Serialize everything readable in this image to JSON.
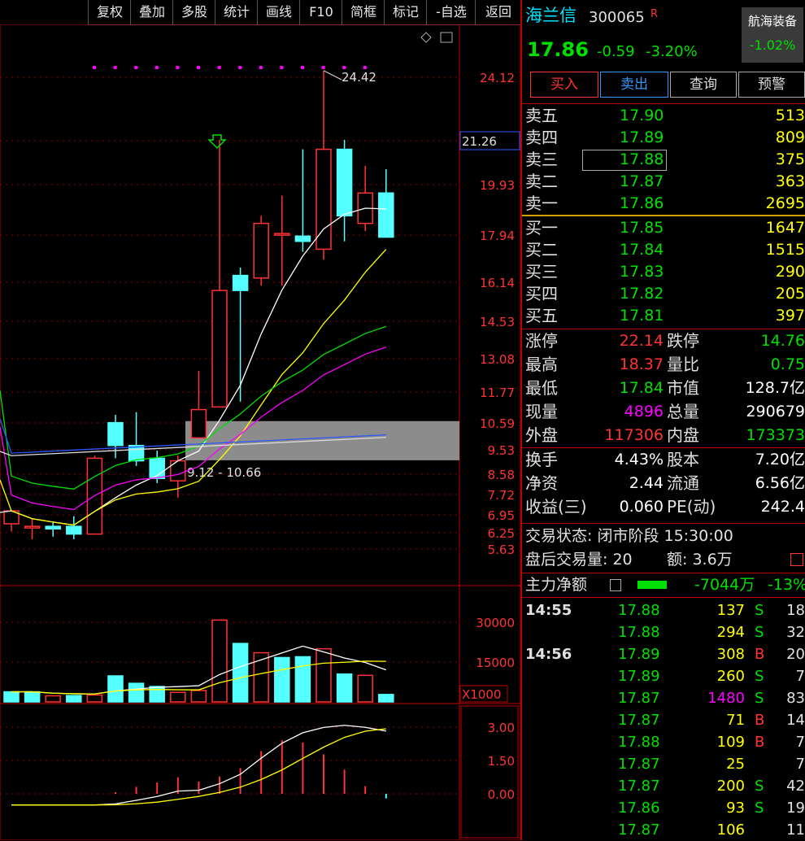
{
  "toolbar": {
    "items": [
      "复权",
      "叠加",
      "多股",
      "统计",
      "画线",
      "F10",
      "简框",
      "标记",
      "-自选",
      "返回"
    ]
  },
  "stock": {
    "name": "海兰信",
    "code": "300065",
    "flag": "R",
    "price": "17.86",
    "change": "-0.59",
    "change_pct": "-3.20%",
    "sector_name": "航海装备",
    "sector_pct": "-1.02%"
  },
  "actions": {
    "buy": "买入",
    "sell": "卖出",
    "query": "查询",
    "alert": "预警"
  },
  "order_book": {
    "asks": [
      {
        "label": "卖五",
        "price": "17.90",
        "vol": "513"
      },
      {
        "label": "卖四",
        "price": "17.89",
        "vol": "809"
      },
      {
        "label": "卖三",
        "price": "17.88",
        "vol": "375"
      },
      {
        "label": "卖二",
        "price": "17.87",
        "vol": "363"
      },
      {
        "label": "卖一",
        "price": "17.86",
        "vol": "2695"
      }
    ],
    "bids": [
      {
        "label": "买一",
        "price": "17.85",
        "vol": "1647"
      },
      {
        "label": "买二",
        "price": "17.84",
        "vol": "1515"
      },
      {
        "label": "买三",
        "price": "17.83",
        "vol": "290"
      },
      {
        "label": "买四",
        "price": "17.82",
        "vol": "205"
      },
      {
        "label": "买五",
        "price": "17.81",
        "vol": "397"
      }
    ]
  },
  "quote": [
    {
      "l1": "涨停",
      "v1": "22.14",
      "l2": "跌停",
      "v2": "14.76"
    },
    {
      "l1": "最高",
      "v1": "18.37",
      "l2": "量比",
      "v2": "0.75"
    },
    {
      "l1": "最低",
      "v1": "17.84",
      "l2": "市值",
      "v2": "128.7亿"
    },
    {
      "l1": "现量",
      "v1": "4896",
      "l2": "总量",
      "v2": "290679"
    },
    {
      "l1": "外盘",
      "v1": "117306",
      "l2": "内盘",
      "v2": "173373"
    }
  ],
  "stats": [
    {
      "l1": "换手",
      "v1": "4.43%",
      "l2": "股本",
      "v2": "7.20亿"
    },
    {
      "l1": "净资",
      "v1": "2.44",
      "l2": "流通",
      "v2": "6.56亿"
    },
    {
      "l1": "收益(三)",
      "v1": "0.060",
      "l2": "PE(动)",
      "v2": "242.4"
    }
  ],
  "trade_status": {
    "status": "交易状态: 闭市阶段 15:30:00",
    "after_hours_label": "盘后交易量: 20",
    "amount_label": "额: 3.6万"
  },
  "main_flow": {
    "label": "主力净额",
    "value": "-7044万",
    "pct": "-13%"
  },
  "ticks": [
    {
      "time": "14:55",
      "price": "17.88",
      "vol": "137",
      "side": "S",
      "count": "18"
    },
    {
      "time": "",
      "price": "17.88",
      "vol": "294",
      "side": "S",
      "count": "32"
    },
    {
      "time": "14:56",
      "price": "17.89",
      "vol": "308",
      "side": "B",
      "count": "20"
    },
    {
      "time": "",
      "price": "17.89",
      "vol": "260",
      "side": "S",
      "count": "7"
    },
    {
      "time": "",
      "price": "17.87",
      "vol": "1480",
      "side": "S",
      "count": "83"
    },
    {
      "time": "",
      "price": "17.87",
      "vol": "71",
      "side": "B",
      "count": "14"
    },
    {
      "time": "",
      "price": "17.88",
      "vol": "109",
      "side": "B",
      "count": "7"
    },
    {
      "time": "",
      "price": "17.87",
      "vol": "25",
      "side": "",
      "count": "7"
    },
    {
      "time": "",
      "price": "17.87",
      "vol": "200",
      "side": "S",
      "count": "42"
    },
    {
      "time": "",
      "price": "17.86",
      "vol": "93",
      "side": "S",
      "count": "19"
    },
    {
      "time": "",
      "price": "17.87",
      "vol": "106",
      "side": "",
      "count": "11"
    }
  ],
  "chart_data": [
    {
      "type": "candlestick",
      "price_ticks": [
        "24.12",
        "21.26",
        "19.93",
        "17.94",
        "16.14",
        "14.53",
        "13.08",
        "11.77",
        "10.59",
        "9.53",
        "8.58",
        "7.72",
        "6.95",
        "6.25",
        "5.63"
      ],
      "highlight_price": "21.26",
      "annotations": {
        "peak": "24.42",
        "range": "9.12 - 10.66"
      },
      "candles": [
        {
          "o": 6.6,
          "h": 7.0,
          "l": 6.3,
          "c": 7.1
        },
        {
          "o": 6.5,
          "h": 6.8,
          "l": 6.0,
          "c": 6.5
        },
        {
          "o": 6.5,
          "h": 6.7,
          "l": 6.1,
          "c": 6.4
        },
        {
          "o": 6.5,
          "h": 6.9,
          "l": 6.0,
          "c": 6.2
        },
        {
          "o": 6.2,
          "h": 9.3,
          "l": 6.2,
          "c": 9.2
        },
        {
          "o": 10.6,
          "h": 10.9,
          "l": 9.2,
          "c": 9.7
        },
        {
          "o": 9.7,
          "h": 11.0,
          "l": 8.9,
          "c": 9.1
        },
        {
          "o": 9.2,
          "h": 9.5,
          "l": 8.2,
          "c": 8.4
        },
        {
          "o": 8.3,
          "h": 9.3,
          "l": 7.6,
          "c": 9.1
        },
        {
          "o": 10.0,
          "h": 12.6,
          "l": 10.0,
          "c": 11.1
        },
        {
          "o": 11.2,
          "h": 21.3,
          "l": 11.2,
          "c": 15.8
        },
        {
          "o": 16.4,
          "h": 16.7,
          "l": 11.4,
          "c": 15.8
        },
        {
          "o": 16.3,
          "h": 18.7,
          "l": 16.0,
          "c": 18.4
        },
        {
          "o": 18.0,
          "h": 19.5,
          "l": 16.0,
          "c": 18.0
        },
        {
          "o": 17.9,
          "h": 21.0,
          "l": 17.3,
          "c": 17.7
        },
        {
          "o": 17.4,
          "h": 24.42,
          "l": 17.0,
          "c": 21.0
        },
        {
          "o": 21.0,
          "h": 21.3,
          "l": 17.7,
          "c": 18.7
        },
        {
          "o": 18.4,
          "h": 20.5,
          "l": 18.1,
          "c": 19.6
        },
        {
          "o": 19.6,
          "h": 20.4,
          "l": 17.9,
          "c": 17.86
        }
      ],
      "band": {
        "low": 9.12,
        "high": 10.66
      }
    },
    {
      "type": "bar",
      "title": "volume",
      "unit": "X1000",
      "yticks": [
        "30000",
        "15000"
      ],
      "values": [
        3800,
        3800,
        2300,
        2400,
        2600,
        9800,
        7000,
        5800,
        3600,
        4300,
        30800,
        22000,
        18500,
        16700,
        17000,
        20000,
        10500,
        10000,
        2800
      ],
      "rising": [
        false,
        false,
        true,
        false,
        true,
        false,
        false,
        false,
        true,
        true,
        true,
        false,
        true,
        false,
        false,
        true,
        false,
        true,
        false
      ]
    },
    {
      "type": "line",
      "title": "macd",
      "yticks": [
        "3.00",
        "1.50",
        "0.00"
      ]
    }
  ]
}
